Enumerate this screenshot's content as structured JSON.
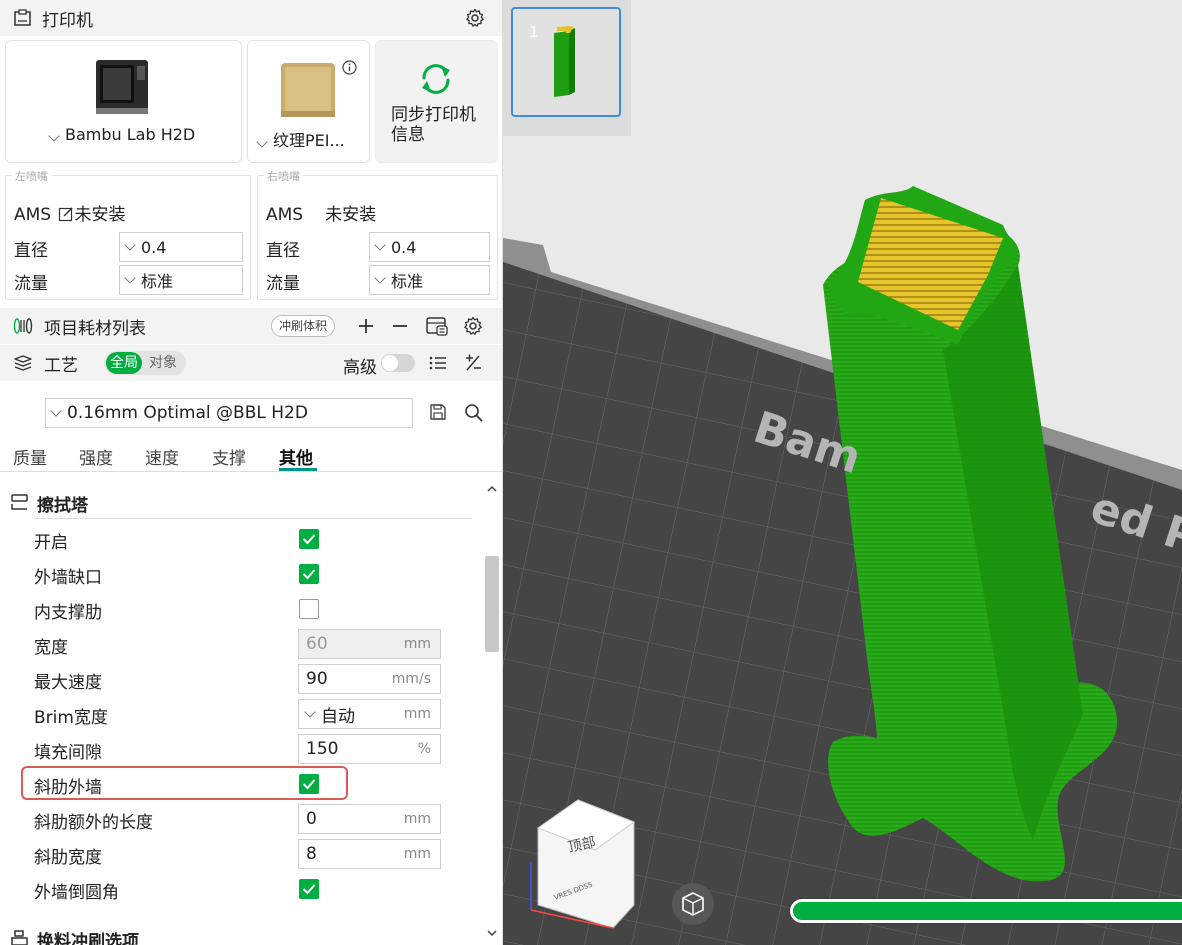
{
  "printer_section": {
    "title": "打印机",
    "printer_name": "Bambu Lab H2D",
    "plate_name": "纹理PEI...",
    "sync_button": "同步打印机信息"
  },
  "left_nozzle": {
    "caption": "左喷嘴",
    "ams_label": "AMS",
    "ams_status": "未安装",
    "diameter_label": "直径",
    "diameter_value": "0.4",
    "flow_label": "流量",
    "flow_value": "标准"
  },
  "right_nozzle": {
    "caption": "右喷嘴",
    "ams_label": "AMS",
    "ams_status": "未安装",
    "diameter_label": "直径",
    "diameter_value": "0.4",
    "flow_label": "流量",
    "flow_value": "标准"
  },
  "filament_section": {
    "title": "项目耗材列表",
    "flush_volume_button": "冲刷体积"
  },
  "process_section": {
    "title": "工艺",
    "toggle_global": "全局",
    "toggle_object": "对象",
    "advanced_label": "高级"
  },
  "preset": {
    "name": "0.16mm Optimal @BBL H2D"
  },
  "tabs": [
    "质量",
    "强度",
    "速度",
    "支撑",
    "其他"
  ],
  "active_tab": "其他",
  "prime_tower": {
    "title": "擦拭塔",
    "enable": {
      "label": "开启",
      "checked": true
    },
    "outer_wall_gap": {
      "label": "外墙缺口",
      "checked": true
    },
    "inner_rib": {
      "label": "内支撑肋",
      "checked": false
    },
    "width": {
      "label": "宽度",
      "value": "60",
      "unit": "mm"
    },
    "max_speed": {
      "label": "最大速度",
      "value": "90",
      "unit": "mm/s"
    },
    "brim_width": {
      "label": "Brim宽度",
      "value": "自动",
      "unit": "mm"
    },
    "infill_gap": {
      "label": "填充间隙",
      "value": "150",
      "unit": "%"
    },
    "rib_wall": {
      "label": "斜肋外墙",
      "checked": true
    },
    "rib_extra_length": {
      "label": "斜肋额外的长度",
      "value": "0",
      "unit": "mm"
    },
    "rib_width": {
      "label": "斜肋宽度",
      "value": "8",
      "unit": "mm"
    },
    "fillet_wall": {
      "label": "外墙倒圆角",
      "checked": true
    }
  },
  "next_section": {
    "title": "换料冲刷选项"
  },
  "viewport": {
    "plate_number": "1",
    "plate_text_left": "Bam",
    "plate_text_right": "ed PEI",
    "cube_face_label": "顶部",
    "cube_side_label": "VRES DDSS",
    "slice_progress": 1.0
  },
  "colors": {
    "accent": "#00ae42",
    "highlight": "#e05757",
    "selection": "#3d8ddd",
    "model_green": "#1f9e12",
    "model_yellow": "#e6c52b"
  }
}
